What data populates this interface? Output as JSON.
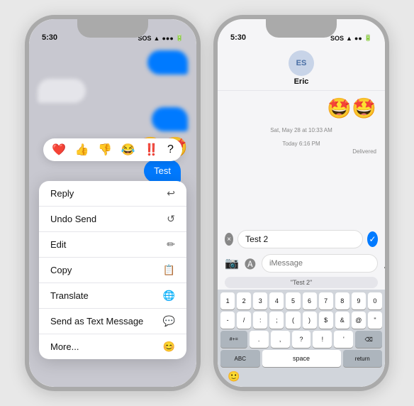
{
  "left_phone": {
    "status_time": "5:30",
    "status_sos": "SOS",
    "reaction_icons": [
      "❤️",
      "👍",
      "👎",
      "😂",
      "‼️",
      "?"
    ],
    "highlighted_bubble_text": "Test",
    "menu_items": [
      {
        "label": "Reply",
        "icon": "↩"
      },
      {
        "label": "Undo Send",
        "icon": "↺"
      },
      {
        "label": "Edit",
        "icon": "✏"
      },
      {
        "label": "Copy",
        "icon": "📋"
      },
      {
        "label": "Translate",
        "icon": "🌐"
      },
      {
        "label": "Send as Text Message",
        "icon": "💬"
      },
      {
        "label": "More...",
        "icon": "😊"
      }
    ]
  },
  "right_phone": {
    "status_time": "5:30",
    "status_sos": "SOS",
    "contact_initials": "ES",
    "contact_name": "Eric",
    "emoji_messages": "🤩🤩",
    "date_label": "Sat, May 28 at 10:33 AM",
    "today_label": "Today 6:16 PM",
    "delivered_label": "Delivered",
    "edit_input_value": "Test 2",
    "message_placeholder": "iMessage",
    "quoted_label": "\"Test 2\"",
    "keyboard": {
      "row1": [
        "1",
        "2",
        "3",
        "4",
        "5",
        "6",
        "7",
        "8",
        "9",
        "0"
      ],
      "row2": [
        "-",
        "/",
        ":",
        ";",
        "(",
        ")",
        "$",
        "&",
        "@",
        "\""
      ],
      "row3_left": "#+",
      "row3_symbols": [
        ".",
        "?",
        "!",
        "'"
      ],
      "row3_right": "⌫",
      "bottom": [
        "ABC",
        "space",
        "return"
      ]
    }
  }
}
